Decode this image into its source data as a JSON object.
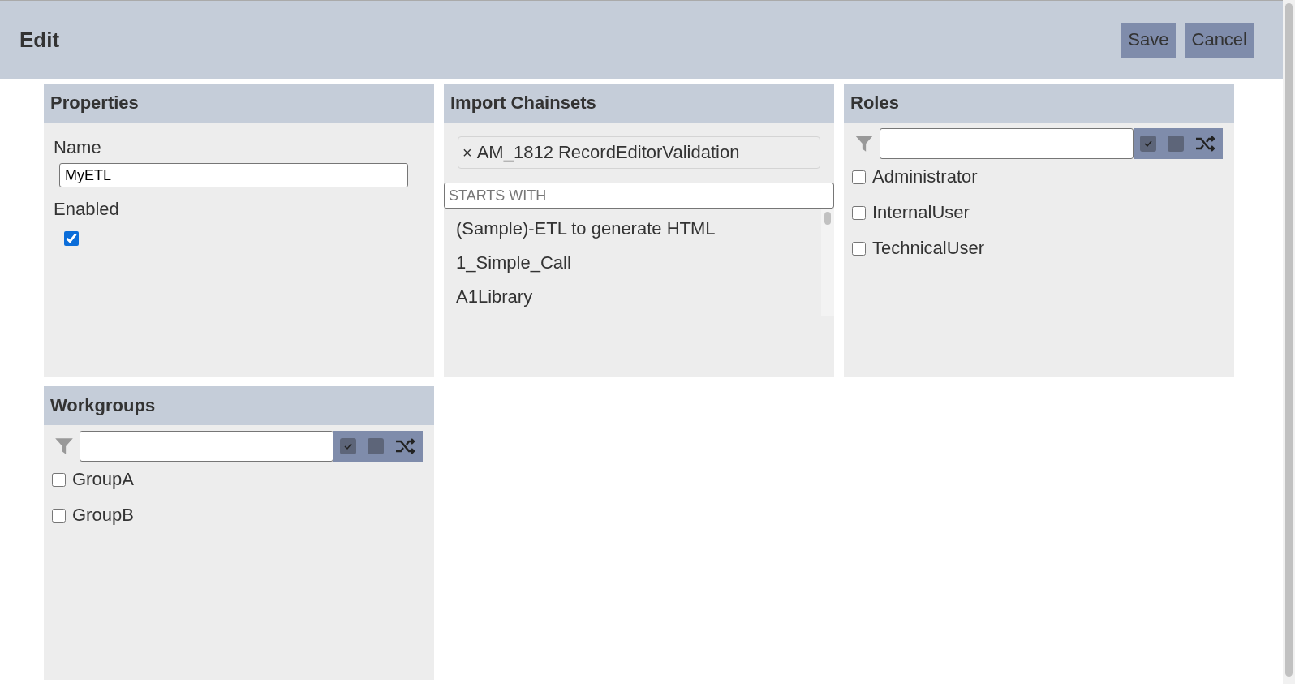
{
  "header": {
    "title": "Edit",
    "buttons": [
      {
        "label": "Save"
      },
      {
        "label": "Cancel"
      }
    ]
  },
  "properties": {
    "title": "Properties",
    "name_label": "Name",
    "name_value": "MyETL",
    "enabled_label": "Enabled",
    "enabled": true
  },
  "import_chainsets": {
    "title": "Import Chainsets",
    "tags": [
      {
        "remove": "×",
        "label": "AM_1812 RecordEditorValidation"
      }
    ],
    "search": {
      "placeholder": "STARTS WITH"
    },
    "options": [
      "(Sample)-ETL to generate HTML",
      "1_Simple_Call",
      "A1Library"
    ]
  },
  "roles": {
    "title": "Roles",
    "items": [
      {
        "label": "Administrator",
        "checked": false
      },
      {
        "label": "InternalUser",
        "checked": false
      },
      {
        "label": "TechnicalUser",
        "checked": false
      }
    ]
  },
  "workgroups": {
    "title": "Workgroups",
    "items": [
      {
        "label": "GroupA",
        "checked": false
      },
      {
        "label": "GroupB",
        "checked": false
      }
    ]
  }
}
